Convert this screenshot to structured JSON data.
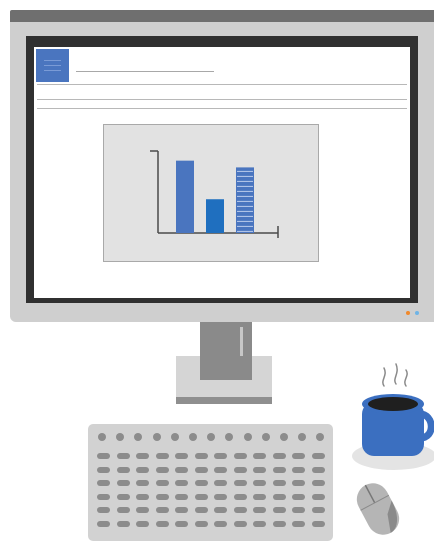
{
  "screen": {
    "doc_title": "",
    "doc_text": "",
    "chart_data": {
      "type": "bar",
      "categories": [
        "",
        "",
        ""
      ],
      "values": [
        75,
        35,
        68
      ],
      "ylim": [
        0,
        85
      ],
      "bar_colors": [
        "#4a75bf",
        "#1f6fbf",
        "#4a75bf"
      ],
      "bar_styles": [
        "solid",
        "solid",
        "striped"
      ],
      "title": "",
      "xlabel": "",
      "ylabel": "",
      "grid": false
    }
  },
  "monitor": {
    "leds": [
      {
        "name": "power-led-orange",
        "color": "#f0892c"
      },
      {
        "name": "power-led-blue",
        "color": "#6fb4e6"
      }
    ]
  },
  "desk": {
    "mug_color": "#3b6fc0",
    "coffee_color": "#1f1f1f",
    "saucer_color": "#e4e4e4",
    "steam_color": "#8a8a8a",
    "mouse_color": "#b5b5b5"
  },
  "icons": [
    "document-icon",
    "steam-icon",
    "mouse-icon",
    "coffee-mug-icon"
  ]
}
